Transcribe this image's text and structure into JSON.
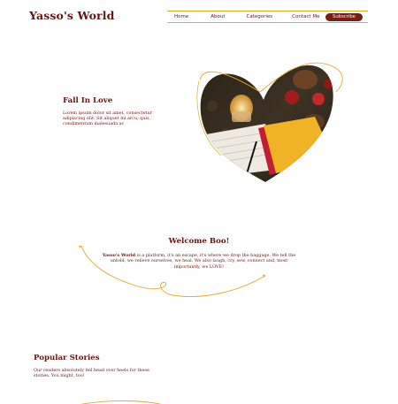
{
  "brand": {
    "logo_text": "Yasso's World"
  },
  "nav": {
    "items": [
      "Home",
      "About",
      "Categories",
      "Contact Me"
    ],
    "subscribe_label": "Subscribe"
  },
  "hero": {
    "title": "Fall In Love",
    "body": "Lorem ipsum dolor sit amet, consectetur adipiscing elit. Sit aliquet mi arcu, quis condimentum malesuada ac",
    "image_icon": "heart-photo-icon"
  },
  "welcome": {
    "title": "Welcome Boo!",
    "brand_name": "Yasso's World",
    "body": " is a platform, it's an escape, it's where we drop the baggage. We tell the untold, we relieve ourselves, we heal. We also laugh, cry, sew, connect and, most importantly, we LOVE!"
  },
  "popular": {
    "title": "Popular Stories",
    "body": "Our readers absolutely fell head over heels for these stories. You might, too!"
  },
  "colors": {
    "maroon": "#6b1212",
    "accent_gold": "#e3a92a",
    "button_bg": "#7a1d17"
  }
}
